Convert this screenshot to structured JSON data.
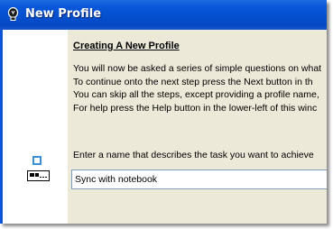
{
  "window": {
    "title": "New Profile",
    "title_icon": "lightbulb-icon"
  },
  "page": {
    "heading": "Creating A New Profile",
    "lines": [
      "You will now be asked a series of simple questions on what",
      "To continue onto the next step press the Next button in th",
      "You can skip all the steps, except providing a profile name,",
      "For help press the Help button in the lower-left of this winc"
    ]
  },
  "steps": {
    "current_step_icon": "step-square-icon",
    "name_step_icon": "name-field-icon"
  },
  "name_field": {
    "prompt": "Enter a name that describes the task you want to achieve",
    "value": "Sync with notebook"
  },
  "colors": {
    "titlebar": "#0350cf",
    "panel": "#ece9d8",
    "step_accent": "#3a8fd6"
  }
}
